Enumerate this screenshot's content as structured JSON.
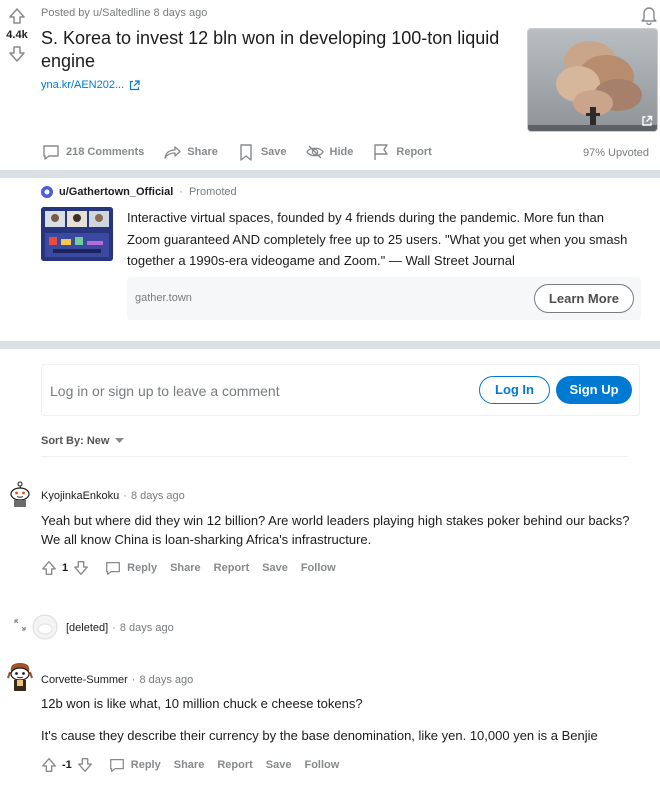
{
  "post": {
    "vote_count": "4.4k",
    "posted_by": "Posted by u/Saltedline 8 days ago",
    "title": "S. Korea to invest 12 bln won in developing 100-ton liquid engine",
    "link_text": "yna.kr/AEN202...",
    "actions": {
      "comments": "218 Comments",
      "share": "Share",
      "save": "Save",
      "hide": "Hide",
      "report": "Report"
    },
    "upvoted": "97% Upvoted"
  },
  "promoted": {
    "user": "u/Gathertown_Official",
    "tag": "Promoted",
    "text": "Interactive virtual spaces, founded by 4 friends during the pandemic. More fun than Zoom guaranteed AND completely free up to 25 users. \"What you get when you smash together a 1990s-era videogame and Zoom.\" — Wall Street Journal",
    "domain": "gather.town",
    "cta": "Learn More"
  },
  "comment_box": {
    "prompt": "Log in or sign up to leave a comment",
    "login": "Log In",
    "signup": "Sign Up"
  },
  "sort": {
    "label": "Sort By: New"
  },
  "comments": [
    {
      "author": "KyojinkaEnkoku",
      "time": "8 days ago",
      "body": "Yeah but where did they win 12 billion? Are world leaders playing high stakes poker behind our backs? We all know China is loan-sharking Africa's infrastructure.",
      "score": "1"
    },
    {
      "author": "[deleted]",
      "time": "8 days ago"
    },
    {
      "author": "Corvette-Summer",
      "time": "8 days ago",
      "body_1": "12b won is like what, 10 million chuck e cheese tokens?",
      "body_2": "It's cause they describe their currency by the base denomination, like yen. 10,000 yen is a Benjie",
      "score": "-1"
    }
  ],
  "comment_actions": {
    "reply": "Reply",
    "share": "Share",
    "report": "Report",
    "save": "Save",
    "follow": "Follow"
  },
  "colors": {
    "accent": "#0079d3",
    "muted": "#787c7e",
    "band": "#dae0e6"
  }
}
